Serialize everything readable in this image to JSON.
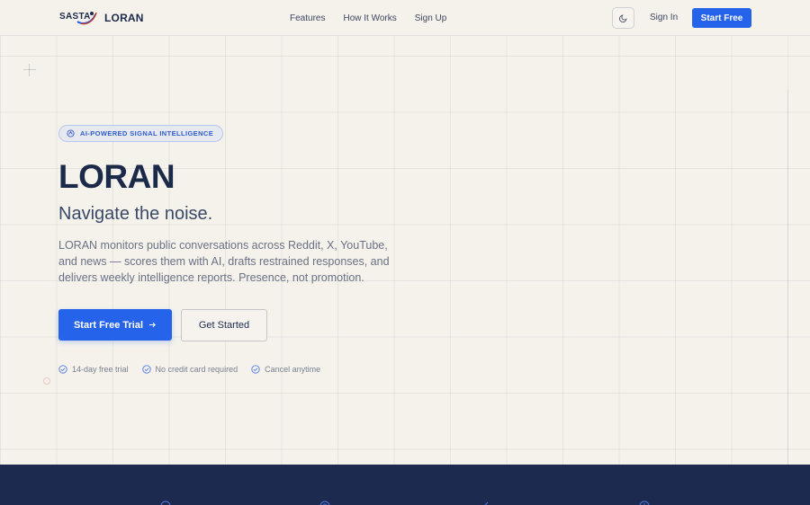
{
  "header": {
    "logo_mark_text": "SASTA",
    "brand": "LORAN",
    "nav": [
      "Features",
      "How It Works",
      "Sign Up"
    ],
    "sign_in": "Sign In",
    "start_free": "Start Free",
    "theme_icon": "moon-icon"
  },
  "hero": {
    "badge": "AI-POWERED SIGNAL INTELLIGENCE",
    "title": "LORAN",
    "tagline": "Navigate the noise.",
    "description": "LORAN monitors public conversations across Reddit, X, YouTube, and news — scores them with AI, drafts restrained responses, and delivers weekly intelligence reports. Presence, not promotion.",
    "primary_cta": "Start Free Trial",
    "secondary_cta": "Get Started",
    "perks": [
      "14-day free trial",
      "No credit card required",
      "Cancel anytime"
    ]
  },
  "colors": {
    "accent": "#2563eb",
    "background": "#f5f2ec",
    "navy": "#1b2a4e"
  }
}
